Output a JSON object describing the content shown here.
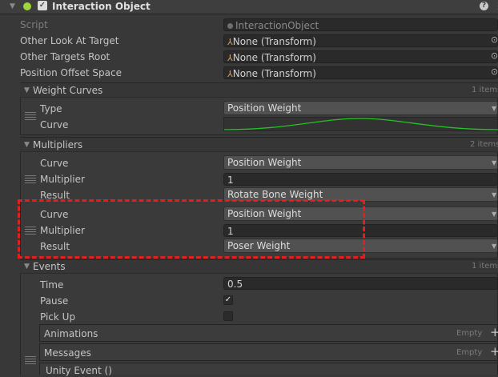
{
  "component": {
    "title": "Interaction Object",
    "help_icon": "help-icon",
    "menu_icon": "more-icon"
  },
  "fields": {
    "script_label": "Script",
    "script_value": "InteractionObject",
    "other_look_at_target_label": "Other Look At Target",
    "other_look_at_target_value": "None (Transform)",
    "other_targets_root_label": "Other Targets Root",
    "other_targets_root_value": "None (Transform)",
    "position_offset_space_label": "Position Offset Space",
    "position_offset_space_value": "None (Transform)"
  },
  "weight_curves": {
    "header": "Weight Curves",
    "count": "1 items",
    "type_label": "Type",
    "type_value": "Position Weight",
    "curve_label": "Curve",
    "curve_color": "#22c322"
  },
  "multipliers": {
    "header": "Multipliers",
    "count": "2 items",
    "items": [
      {
        "curve_label": "Curve",
        "curve_value": "Position Weight",
        "multiplier_label": "Multiplier",
        "multiplier_value": "1",
        "result_label": "Result",
        "result_value": "Rotate Bone Weight"
      },
      {
        "curve_label": "Curve",
        "curve_value": "Position Weight",
        "multiplier_label": "Multiplier",
        "multiplier_value": "1",
        "result_label": "Result",
        "result_value": "Poser Weight"
      }
    ],
    "highlight_color": "#e01f1f"
  },
  "events": {
    "header": "Events",
    "count": "1 items",
    "time_label": "Time",
    "time_value": "0.5",
    "pause_label": "Pause",
    "pause_checked": true,
    "pickup_label": "Pick Up",
    "pickup_checked": false,
    "animations_label": "Animations",
    "animations_status": "Empty",
    "messages_label": "Messages",
    "messages_status": "Empty",
    "unity_event_label": "Unity Event ()"
  }
}
